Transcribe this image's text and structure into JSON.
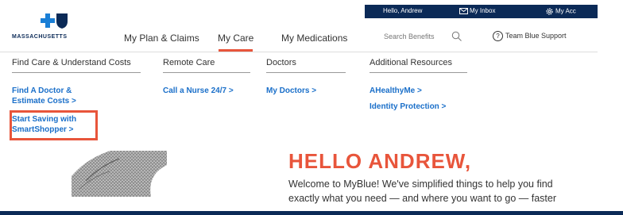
{
  "utility_bar": {
    "greeting": "Hello, Andrew",
    "inbox": "My Inbox",
    "account": "My Acc"
  },
  "logo": {
    "wordmark": "MASSACHUSETTS"
  },
  "nav": {
    "tabs": [
      "My Plan & Claims",
      "My Care",
      "My Medications"
    ],
    "active": "My Care"
  },
  "search": {
    "placeholder": "Search Benefits"
  },
  "support": {
    "label": "Team Blue Support"
  },
  "menu": {
    "columns": [
      {
        "heading": "Find Care & Understand Costs",
        "links": [
          "Find A Doctor & Estimate Costs >",
          "Start Saving with SmartShopper >"
        ]
      },
      {
        "heading": "Remote Care",
        "links": [
          "Call a Nurse 24/7 >"
        ]
      },
      {
        "heading": "Doctors",
        "links": [
          "My Doctors >"
        ]
      },
      {
        "heading": "Additional Resources",
        "links": [
          "AHealthyMe >",
          "Identity Protection >"
        ]
      }
    ]
  },
  "hero": {
    "title": "HELLO ANDREW,",
    "body": "Welcome to MyBlue! We've simplified things to help you find exactly what you need — and where you want to go — faster"
  },
  "colors": {
    "navy": "#0b2a57",
    "accent": "#e8553b",
    "link": "#1a6fc9"
  }
}
